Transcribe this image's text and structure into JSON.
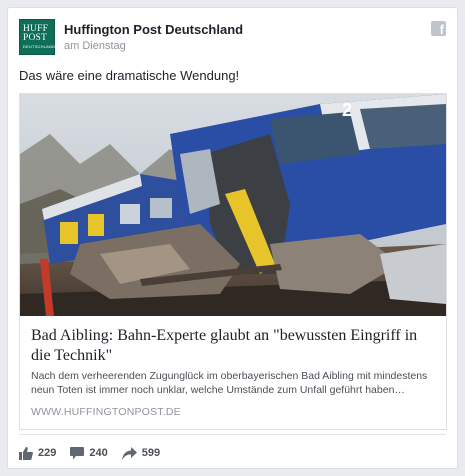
{
  "post": {
    "page_name": "Huffington Post Deutschland",
    "timestamp": "am Dienstag",
    "text": "Das wäre eine dramatische Wendung!",
    "avatar": {
      "line1": "HUFF",
      "line2": "POST",
      "line3": "DEUTSCHLAND",
      "color": "#0e6e58"
    },
    "brand_icon": "facebook-icon"
  },
  "link": {
    "image": "train-crash-photo",
    "title": "Bad Aibling: Bahn-Experte glaubt an \"bewussten Eingriff in die Technik\"",
    "description": "Nach dem verheerenden Zugunglück im oberbayerischen Bad Aibling mit mindestens neun Toten ist immer noch unklar, welche Umstände zum Unfall geführt haben…",
    "domain": "WWW.HUFFINGTONPOST.DE"
  },
  "actions": [
    {
      "icon": "like-icon",
      "count": "229"
    },
    {
      "icon": "comment-icon",
      "count": "240"
    },
    {
      "icon": "share-icon",
      "count": "599"
    }
  ],
  "colors": {
    "text": "#1d2129",
    "meta": "#90949c",
    "border": "#dddfe2",
    "icon": "#606770"
  }
}
